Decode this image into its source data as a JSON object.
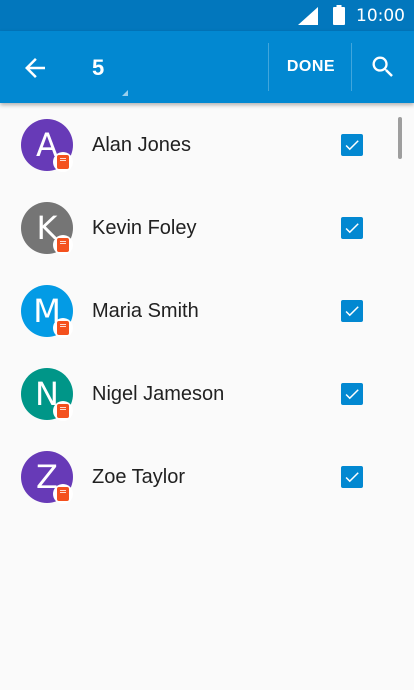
{
  "status_bar": {
    "time": "10:00",
    "icons": [
      "signal-icon",
      "battery-icon"
    ]
  },
  "toolbar": {
    "back_icon": "arrow-back-icon",
    "selected_count": "5",
    "done_label": "DONE",
    "search_icon": "search-icon",
    "color": "#0288d1"
  },
  "contacts": [
    {
      "initial": "A",
      "name": "Alan Jones",
      "color": "#673ab7",
      "checked": true,
      "sim_icon": "sim-card-icon"
    },
    {
      "initial": "K",
      "name": "Kevin Foley",
      "color": "#757575",
      "checked": true,
      "sim_icon": "sim-card-icon"
    },
    {
      "initial": "M",
      "name": "Maria Smith",
      "color": "#039be5",
      "checked": true,
      "sim_icon": "sim-card-icon"
    },
    {
      "initial": "N",
      "name": "Nigel Jameson",
      "color": "#009688",
      "checked": true,
      "sim_icon": "sim-card-icon"
    },
    {
      "initial": "Z",
      "name": "Zoe Taylor",
      "color": "#673ab7",
      "checked": true,
      "sim_icon": "sim-card-icon"
    }
  ]
}
